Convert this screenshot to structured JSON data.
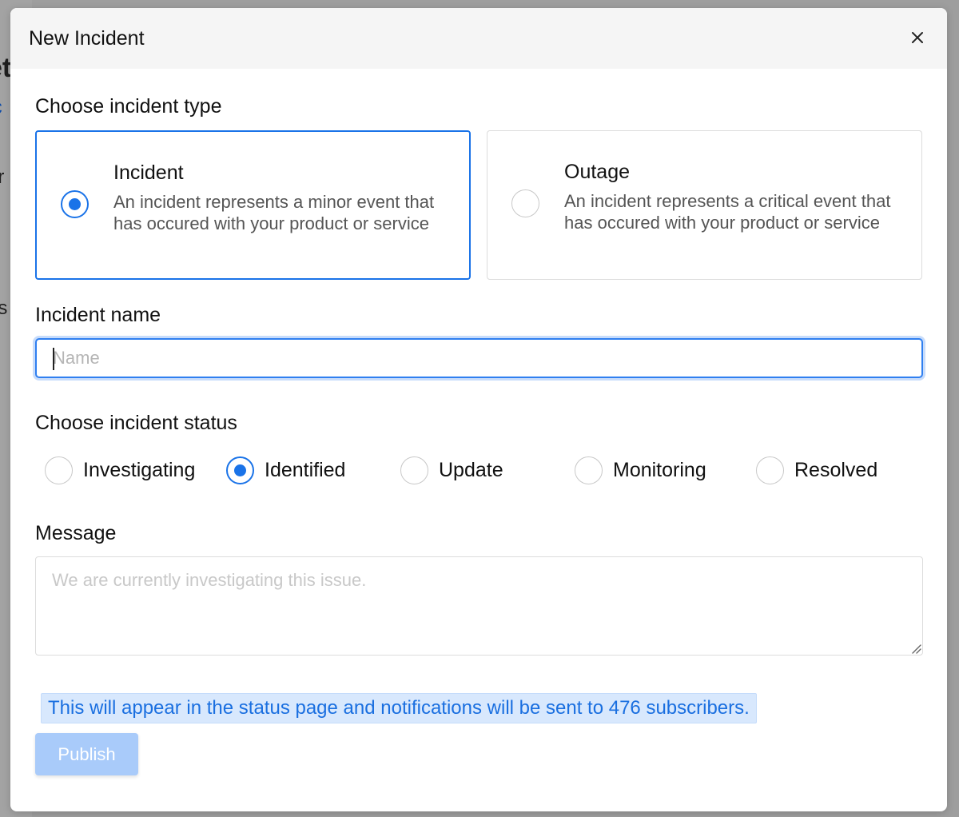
{
  "background": {
    "fragments": [
      "et",
      "ic",
      "t r",
      "o",
      "rt",
      "us"
    ]
  },
  "modal": {
    "title": "New Incident",
    "close_icon": "close-icon"
  },
  "incident_type": {
    "label": "Choose incident type",
    "selected": "incident",
    "options": [
      {
        "id": "incident",
        "title": "Incident",
        "description": "An incident represents a minor event that has occured with your product or service"
      },
      {
        "id": "outage",
        "title": "Outage",
        "description": "An incident represents a critical event that has occured with your product or service"
      }
    ]
  },
  "incident_name": {
    "label": "Incident name",
    "placeholder": "Name",
    "value": ""
  },
  "incident_status": {
    "label": "Choose incident status",
    "selected": "Identified",
    "options": [
      "Investigating",
      "Identified",
      "Update",
      "Monitoring",
      "Resolved"
    ]
  },
  "message": {
    "label": "Message",
    "placeholder": "We are currently investigating this issue.",
    "value": ""
  },
  "notice": {
    "text": "This will appear in the status page and notifications will be sent to 476 subscribers."
  },
  "publish": {
    "label": "Publish",
    "disabled": true
  },
  "colors": {
    "accent": "#1a73e8",
    "notice_bg": "#d8e8fd",
    "publish_disabled": "#a9cbfa"
  }
}
